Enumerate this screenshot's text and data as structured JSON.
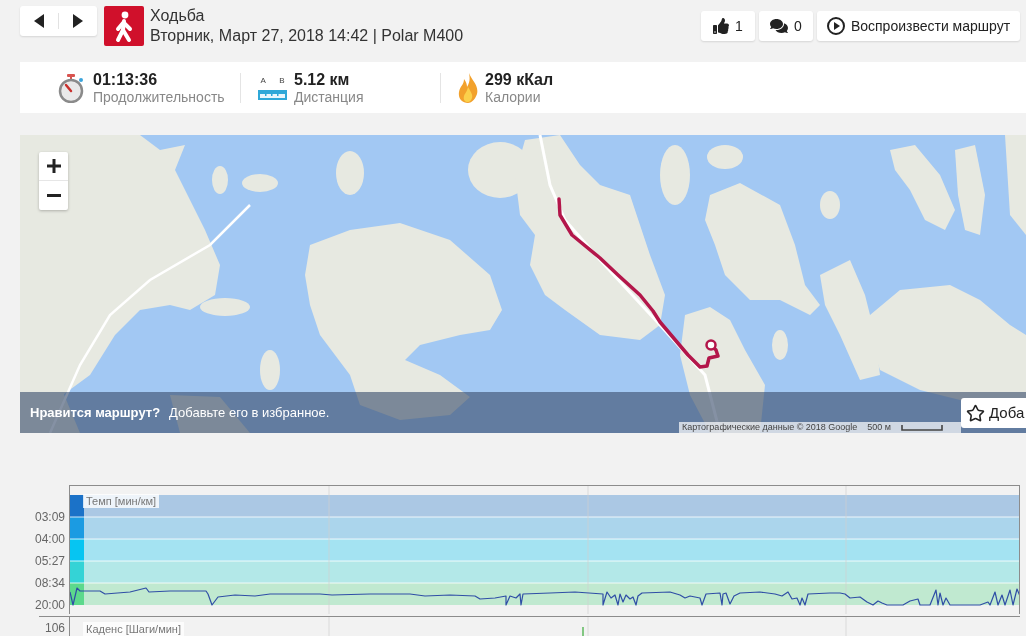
{
  "nav": [
    {
      "kind": "previous"
    },
    {
      "kind": "next"
    }
  ],
  "activity": {
    "title": "Ходьба",
    "subtitle": "Вторник, Март 27, 2018 14:42 | Polar M400"
  },
  "actions": [
    {
      "kind": "like",
      "label": "1"
    },
    {
      "kind": "comment",
      "label": "0"
    },
    {
      "kind": "play",
      "label": "Воспроизвести маршрут"
    }
  ],
  "stats": [
    {
      "kind": "duration",
      "value": "01:13:36",
      "label": "Продолжительность"
    },
    {
      "kind": "distance",
      "icon_letters": [
        "A",
        "B"
      ],
      "value": "5.12 км",
      "label": "Дистанция"
    },
    {
      "kind": "calories",
      "value": "299 кКал",
      "label": "Калории"
    }
  ],
  "map": {
    "banner": {
      "question": "Нравится маршрут?",
      "text": "Добавьте его в избранное."
    },
    "favorite_button": "Доба",
    "attribution": "Картографические данные © 2018 Google",
    "scale": "500 м"
  },
  "charts": [
    {
      "kind": "pace",
      "title": "Темп [мин/км]",
      "y_labels": [
        "03:09",
        "04:00",
        "05:27",
        "08:34",
        "20:00"
      ],
      "zones": [
        {
          "color": "#1b72c8"
        },
        {
          "color": "#1b9be2"
        },
        {
          "color": "#06c5f2"
        },
        {
          "color": "#34d3d6"
        },
        {
          "color": "#5cd98c"
        }
      ]
    },
    {
      "kind": "cadence",
      "title": "Каденс [Шаги/мин]",
      "y_labels": [
        "106"
      ]
    }
  ]
}
